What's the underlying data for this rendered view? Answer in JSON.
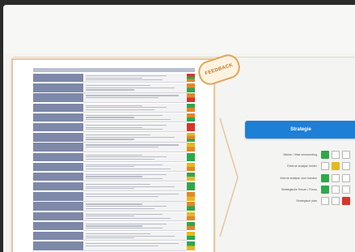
{
  "colors": {
    "accent": "#1e7fd6",
    "green": "#2ea84a",
    "yellow": "#e5b820",
    "red": "#d9342b",
    "orange": "#e3862b",
    "label_bg": "#7e88a8",
    "stamp": "#e0a55a"
  },
  "document": {
    "rows": [
      {
        "label": "",
        "status": [
          "red",
          "green",
          "orange"
        ]
      },
      {
        "label": "",
        "status": [
          "orange",
          "green"
        ]
      },
      {
        "label": "",
        "status": [
          "orange",
          "red"
        ]
      },
      {
        "label": "",
        "status": [
          "green",
          "orange"
        ]
      },
      {
        "label": "",
        "status": [
          "orange",
          "green"
        ]
      },
      {
        "label": "",
        "status": [
          "red",
          "red"
        ]
      },
      {
        "label": "",
        "status": [
          "yellow",
          "orange",
          "green"
        ]
      },
      {
        "label": "",
        "status": [
          "yellow",
          "orange"
        ]
      },
      {
        "label": "",
        "status": [
          "green",
          "green"
        ]
      },
      {
        "label": "",
        "status": [
          "yellow",
          "orange"
        ]
      },
      {
        "label": "",
        "status": [
          "green",
          "yellow"
        ]
      },
      {
        "label": "",
        "status": [
          "green",
          "green"
        ]
      },
      {
        "label": "",
        "status": [
          "orange",
          "yellow"
        ]
      },
      {
        "label": "",
        "status": [
          "orange",
          "green"
        ]
      },
      {
        "label": "",
        "status": [
          "yellow",
          "orange"
        ]
      },
      {
        "label": "",
        "status": [
          "green",
          "orange"
        ]
      },
      {
        "label": "",
        "status": [
          "yellow",
          "green"
        ]
      },
      {
        "label": "",
        "status": [
          "green",
          "yellow"
        ]
      }
    ]
  },
  "stamp": {
    "text": "FEEDBACK"
  },
  "strategy_button": {
    "label": "Strategie"
  },
  "criteria": [
    {
      "label": "Missie / Visie verwoording",
      "boxes": [
        "green",
        "empty",
        "empty"
      ]
    },
    {
      "label": "Externe analyse helder",
      "boxes": [
        "empty",
        "yellow",
        "empty"
      ]
    },
    {
      "label": "Interne analyse voor handen",
      "boxes": [
        "green",
        "empty",
        "empty"
      ]
    },
    {
      "label": "Strategische Keuze / Focus",
      "boxes": [
        "green",
        "empty",
        "empty"
      ]
    },
    {
      "label": "Strategisch plan",
      "boxes": [
        "empty",
        "empty",
        "red"
      ]
    }
  ]
}
